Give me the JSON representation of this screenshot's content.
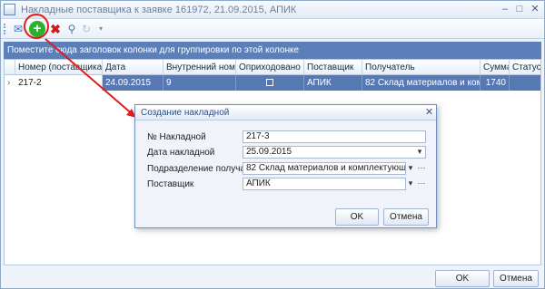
{
  "window": {
    "title": "Накладные поставщика к заявке 161972, 21.09.2015, АПИК",
    "minimize_glyph": "–",
    "maximize_glyph": "□",
    "close_glyph": "✕"
  },
  "toolbar": {
    "open_icon": "envelope-icon",
    "add_icon": "plus-icon",
    "delete_icon": "delete-x-icon",
    "search_icon": "magnifier-icon",
    "refresh_icon": "refresh-icon",
    "add_glyph": "+",
    "delete_glyph": "✖",
    "search_glyph": "⚲",
    "refresh_glyph": "↻",
    "dropdown_glyph": "▾",
    "open_glyph": "✉"
  },
  "grid": {
    "group_panel_text": "Поместите сюда заголовок колонки для группировки по этой колонке",
    "columns": [
      "Номер (поставщика)",
      "Дата",
      "Внутренний номер",
      "Оприходовано",
      "Поставщик",
      "Получатель",
      "Сумма",
      "Статус"
    ],
    "rows": [
      {
        "indicator": "›",
        "number": "217-2",
        "date": "24.09.2015",
        "internal_number": "9",
        "supplier": "АПИК",
        "recipient": "82 Склад материалов и комплек...",
        "sum": "1740",
        "status": ""
      }
    ]
  },
  "footer": {
    "ok_label": "OK",
    "cancel_label": "Отмена"
  },
  "dialog": {
    "title": "Создание накладной",
    "close_glyph": "✕",
    "fields": {
      "number_label": "№ Накладной",
      "number_value": "217-3",
      "date_label": "Дата накладной",
      "date_value": "25.09.2015",
      "department_label": "Подразделение получатель",
      "department_value": "82 Склад материалов и комплектующих",
      "supplier_label": "Поставщик",
      "supplier_value": "АПИК"
    },
    "dropdown_glyph": "▾",
    "ellipsis_glyph": "···",
    "ok_label": "OK",
    "cancel_label": "Отмена"
  },
  "colors": {
    "accent": "#5779b3",
    "highlight_red": "#e31b1b",
    "add_green": "#2db02d"
  }
}
